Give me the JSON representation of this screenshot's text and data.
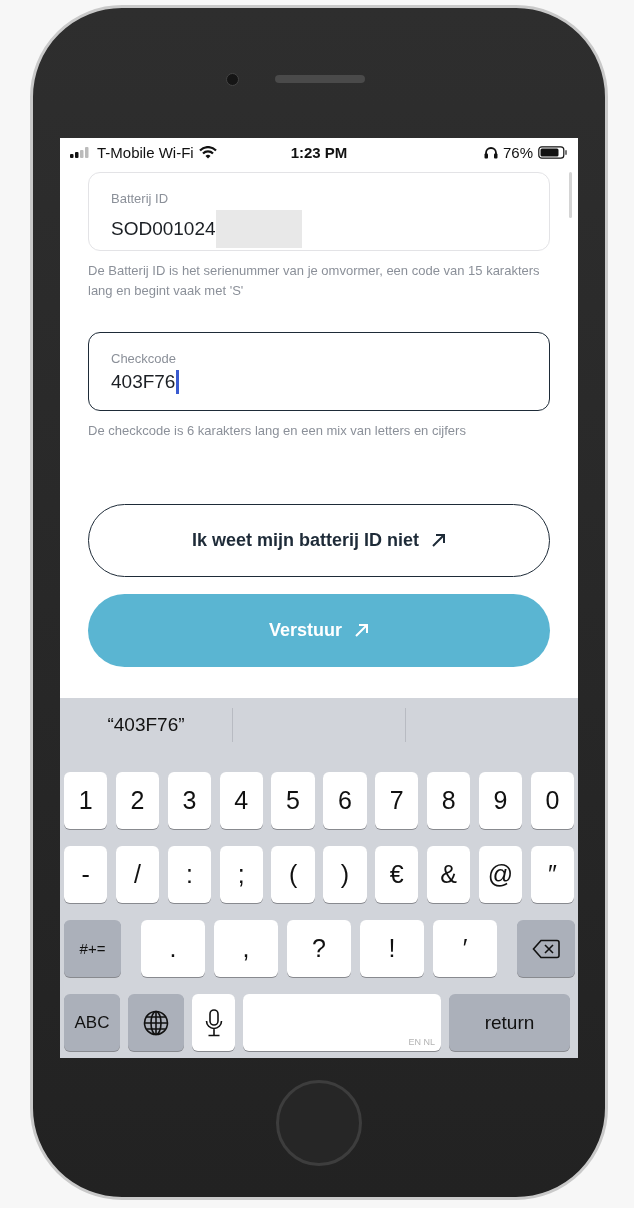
{
  "status_bar": {
    "carrier": "T-Mobile Wi-Fi",
    "time": "1:23 PM",
    "battery": "76%"
  },
  "fields": [
    {
      "label": "Batterij ID",
      "value": "SOD001024",
      "redacted": true,
      "focused": false,
      "hint": "De Batterij ID is het serienummer van je omvormer, een code van 15 karakters lang en begint vaak met 'S'"
    },
    {
      "label": "Checkcode",
      "value": "403F76",
      "focused": true,
      "hint": "De checkcode is 6 karakters lang en een mix van letters en cijfers"
    }
  ],
  "buttons": [
    {
      "label": "Ik weet mijn batterij ID niet",
      "kind": "outline"
    },
    {
      "label": "Verstuur",
      "kind": "primary"
    }
  ],
  "keyboard": {
    "suggestions": [
      "“403F76”"
    ],
    "number_row": [
      {
        "kind": "char",
        "label": "1"
      },
      {
        "kind": "char",
        "label": "2"
      },
      {
        "kind": "char",
        "label": "3"
      },
      {
        "kind": "char",
        "label": "4"
      },
      {
        "kind": "char",
        "label": "5"
      },
      {
        "kind": "char",
        "label": "6"
      },
      {
        "kind": "char",
        "label": "7"
      },
      {
        "kind": "char",
        "label": "8"
      },
      {
        "kind": "char",
        "label": "9"
      },
      {
        "kind": "char",
        "label": "0"
      }
    ],
    "symbol_row": [
      {
        "kind": "char",
        "label": "-"
      },
      {
        "kind": "char",
        "label": "/"
      },
      {
        "kind": "char",
        "label": ":"
      },
      {
        "kind": "char",
        "label": ";"
      },
      {
        "kind": "char",
        "label": "("
      },
      {
        "kind": "char",
        "label": ")"
      },
      {
        "kind": "char",
        "label": "€"
      },
      {
        "kind": "char",
        "label": "&"
      },
      {
        "kind": "char",
        "label": "@"
      },
      {
        "kind": "char",
        "label": "″"
      }
    ],
    "punctuation_row": [
      {
        "kind": "function",
        "label": "#+="
      },
      {
        "kind": "wide",
        "label": "."
      },
      {
        "kind": "wide",
        "label": ","
      },
      {
        "kind": "wide",
        "label": "?"
      },
      {
        "kind": "wide",
        "label": "!"
      },
      {
        "kind": "wide",
        "label": "′"
      },
      {
        "kind": "delete"
      }
    ],
    "bottom_row": [
      {
        "kind": "function",
        "label": "ABC"
      },
      {
        "kind": "globe"
      },
      {
        "kind": "mic"
      },
      {
        "kind": "space",
        "label": "EN NL"
      },
      {
        "kind": "return",
        "label": "return"
      }
    ]
  }
}
